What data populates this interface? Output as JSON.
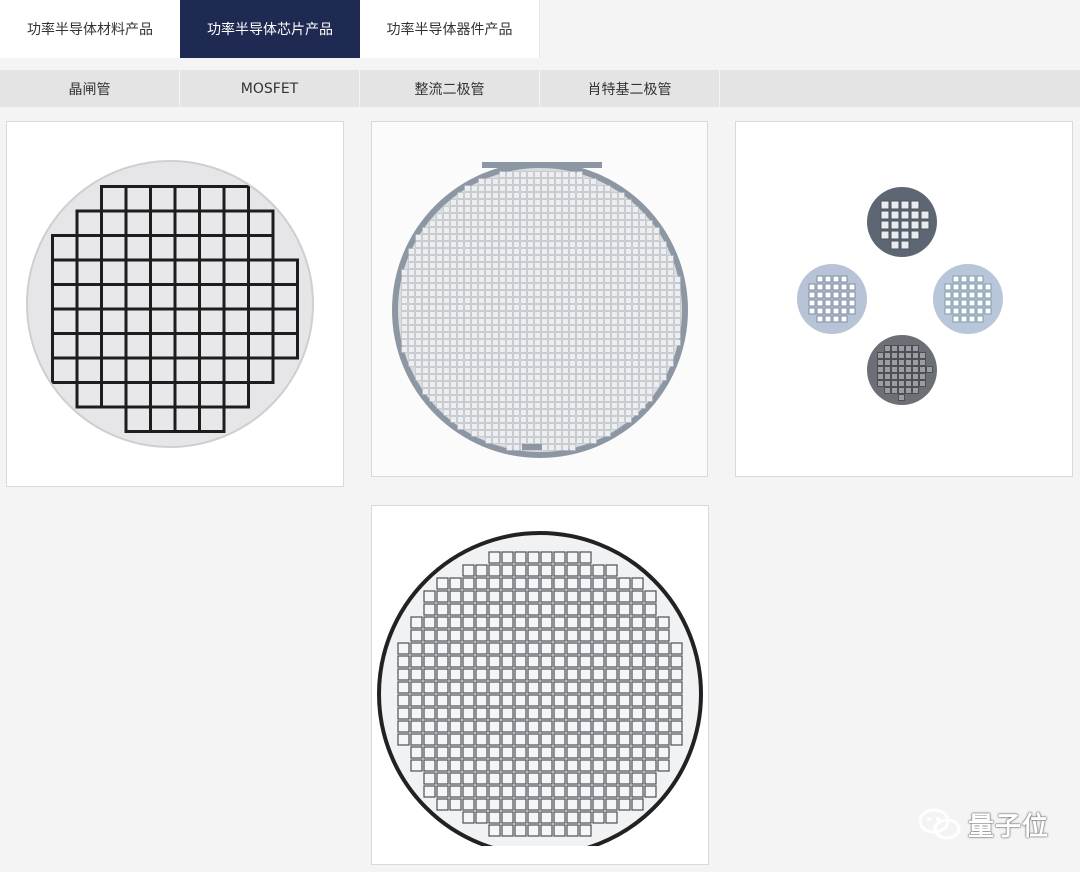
{
  "top_tabs": [
    {
      "label": "功率半导体材料产品",
      "active": false
    },
    {
      "label": "功率半导体芯片产品",
      "active": true
    },
    {
      "label": "功率半导体器件产品",
      "active": false
    }
  ],
  "sub_tabs": [
    {
      "label": "晶闸管"
    },
    {
      "label": "MOSFET"
    },
    {
      "label": "整流二极管"
    },
    {
      "label": "肖特基二极管"
    }
  ],
  "products": [
    {
      "icon": "thyristor-wafer-image"
    },
    {
      "icon": "mosfet-wafer-image"
    },
    {
      "icon": "rectifier-diode-wafers-image"
    },
    {
      "icon": "schottky-diode-wafer-image"
    }
  ],
  "watermark": {
    "text": "量子位",
    "icon": "wechat-icon"
  },
  "colors": {
    "active_tab": "#1f2a52",
    "sub_bar": "#e4e4e4",
    "page_bg": "#f4f4f4"
  }
}
